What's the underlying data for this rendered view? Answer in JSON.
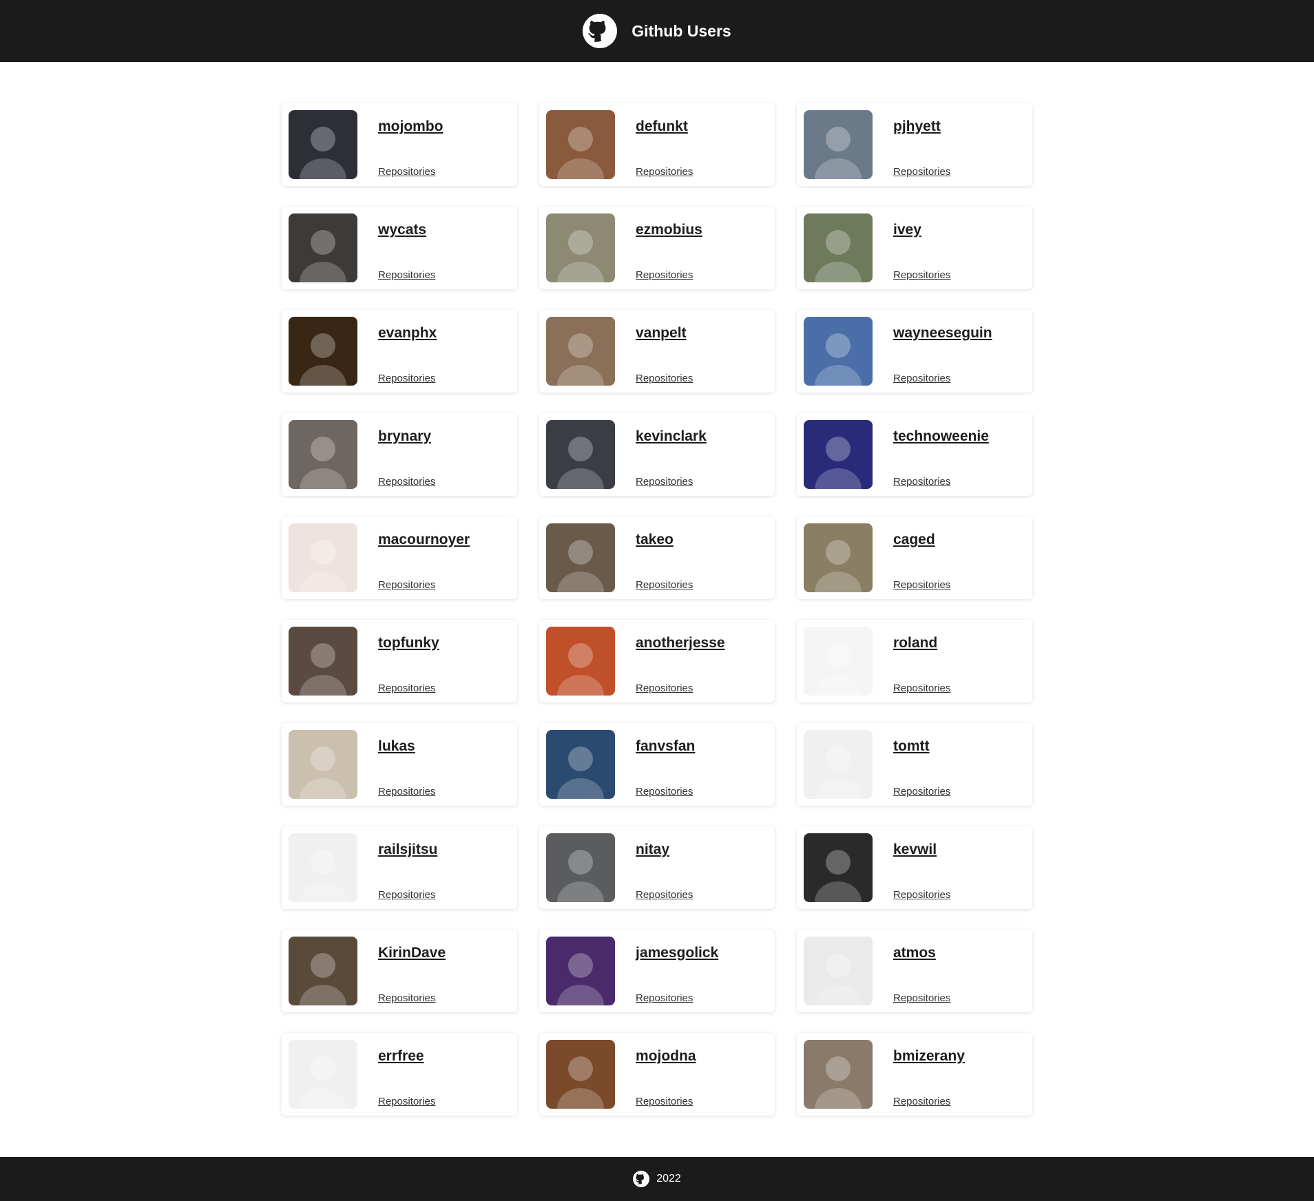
{
  "header": {
    "title": "Github Users",
    "logo_icon": "github-icon"
  },
  "users": [
    {
      "login": "mojombo",
      "repos_label": "Repositories",
      "avatar_color": "#2c3036"
    },
    {
      "login": "defunkt",
      "repos_label": "Repositories",
      "avatar_color": "#8a5a3c"
    },
    {
      "login": "pjhyett",
      "repos_label": "Repositories",
      "avatar_color": "#6b7a88"
    },
    {
      "login": "wycats",
      "repos_label": "Repositories",
      "avatar_color": "#3e3a38"
    },
    {
      "login": "ezmobius",
      "repos_label": "Repositories",
      "avatar_color": "#8c8a72"
    },
    {
      "login": "ivey",
      "repos_label": "Repositories",
      "avatar_color": "#6f7a5c"
    },
    {
      "login": "evanphx",
      "repos_label": "Repositories",
      "avatar_color": "#3a2614"
    },
    {
      "login": "vanpelt",
      "repos_label": "Repositories",
      "avatar_color": "#8a7058"
    },
    {
      "login": "wayneeseguin",
      "repos_label": "Repositories",
      "avatar_color": "#4a6fa8"
    },
    {
      "login": "brynary",
      "repos_label": "Repositories",
      "avatar_color": "#6e6660"
    },
    {
      "login": "kevinclark",
      "repos_label": "Repositories",
      "avatar_color": "#3b3d44"
    },
    {
      "login": "technoweenie",
      "repos_label": "Repositories",
      "avatar_color": "#2a2a7a"
    },
    {
      "login": "macournoyer",
      "repos_label": "Repositories",
      "avatar_color": "#efe3df"
    },
    {
      "login": "takeo",
      "repos_label": "Repositories",
      "avatar_color": "#6a5a4a"
    },
    {
      "login": "caged",
      "repos_label": "Repositories",
      "avatar_color": "#8a7e64"
    },
    {
      "login": "topfunky",
      "repos_label": "Repositories",
      "avatar_color": "#5a4a40"
    },
    {
      "login": "anotherjesse",
      "repos_label": "Repositories",
      "avatar_color": "#c0502a"
    },
    {
      "login": "roland",
      "repos_label": "Repositories",
      "avatar_color": "#f5f5f5"
    },
    {
      "login": "lukas",
      "repos_label": "Repositories",
      "avatar_color": "#cbbfae"
    },
    {
      "login": "fanvsfan",
      "repos_label": "Repositories",
      "avatar_color": "#2a4a70"
    },
    {
      "login": "tomtt",
      "repos_label": "Repositories",
      "avatar_color": "#f0f0f0"
    },
    {
      "login": "railsjitsu",
      "repos_label": "Repositories",
      "avatar_color": "#f0f0f0"
    },
    {
      "login": "nitay",
      "repos_label": "Repositories",
      "avatar_color": "#5a5c5e"
    },
    {
      "login": "kevwil",
      "repos_label": "Repositories",
      "avatar_color": "#2a2a2a"
    },
    {
      "login": "KirinDave",
      "repos_label": "Repositories",
      "avatar_color": "#5a4a3a"
    },
    {
      "login": "jamesgolick",
      "repos_label": "Repositories",
      "avatar_color": "#4a2a6a"
    },
    {
      "login": "atmos",
      "repos_label": "Repositories",
      "avatar_color": "#eaeaea"
    },
    {
      "login": "errfree",
      "repos_label": "Repositories",
      "avatar_color": "#f0f0f0"
    },
    {
      "login": "mojodna",
      "repos_label": "Repositories",
      "avatar_color": "#7a4a2a"
    },
    {
      "login": "bmizerany",
      "repos_label": "Repositories",
      "avatar_color": "#8a7a6a"
    }
  ],
  "footer": {
    "year": "2022",
    "logo_icon": "github-icon"
  }
}
